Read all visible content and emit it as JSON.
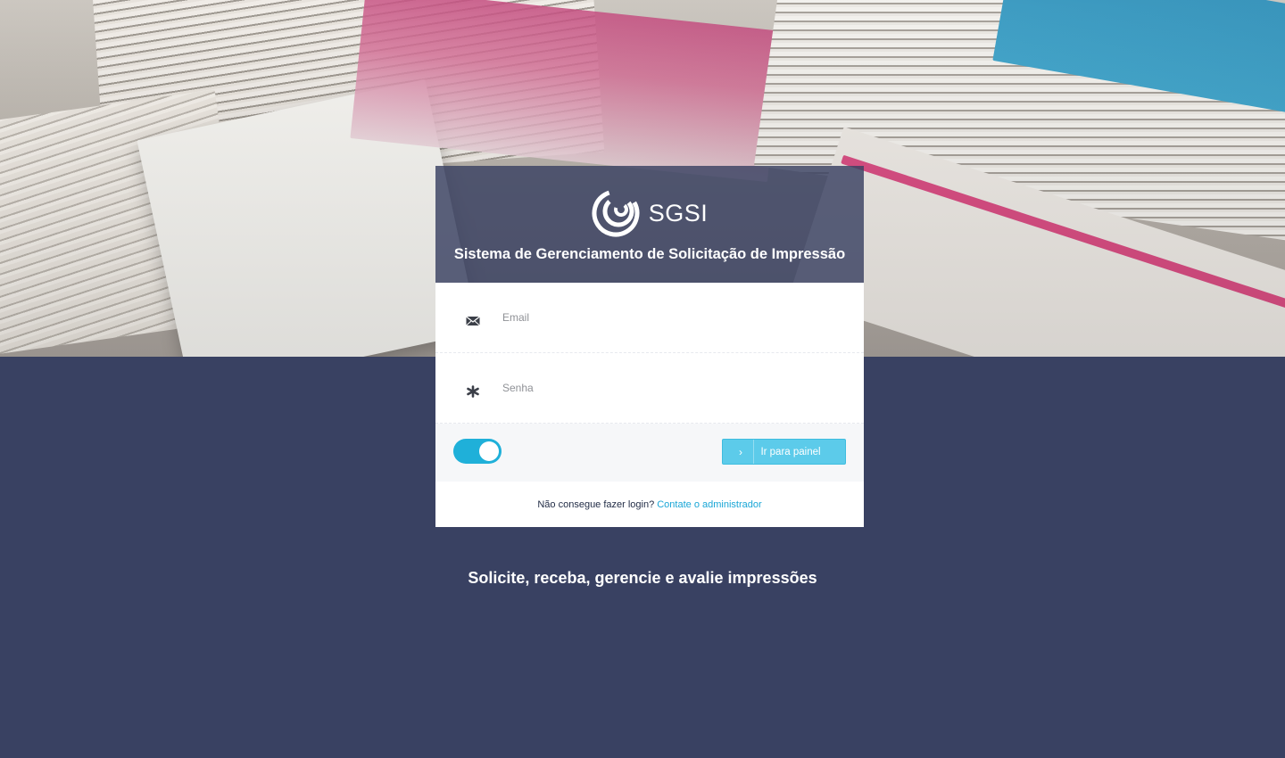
{
  "brand": {
    "logo_text": "SGSI",
    "system_name": "Sistema de Gerenciamento de Solicitação de Impressão"
  },
  "login_form": {
    "email": {
      "placeholder": "Email",
      "value": "",
      "icon": "envelope-icon"
    },
    "password": {
      "placeholder": "Senha",
      "value": "",
      "icon": "asterisk-icon"
    },
    "remember_toggle": {
      "state": "on"
    },
    "submit_label": "Ir para painel",
    "submit_icon": "chevron-right-icon"
  },
  "help": {
    "question": "Não consegue fazer login?",
    "link_text": "Contate o administrador"
  },
  "tagline": "Solicite, receba, gerencie e avalie impressões",
  "colors": {
    "background": "#394162",
    "accent": "#1fb0d9",
    "button": "#5ccbea",
    "link": "#19a6d6"
  }
}
